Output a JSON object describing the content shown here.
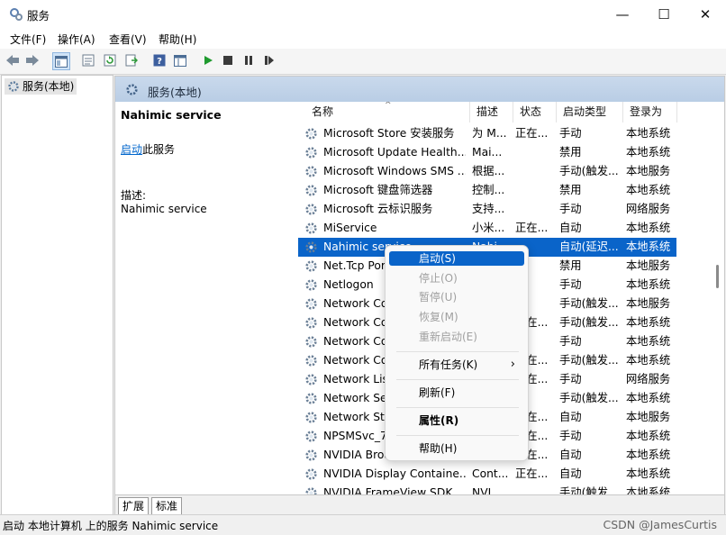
{
  "window": {
    "title": "服务",
    "controls": {
      "minimize": "—",
      "maximize": "☐",
      "close": "✕"
    }
  },
  "menubar": {
    "items": [
      "文件(F)",
      "操作(A)",
      "查看(V)",
      "帮助(H)"
    ]
  },
  "toolbar": {
    "icons": [
      "back-arrow-icon",
      "forward-arrow-icon",
      "show-hide-tree-icon",
      "properties-icon",
      "refresh-icon",
      "export-list-icon",
      "help-icon",
      "view-icon",
      "start-service-icon",
      "stop-service-icon",
      "pause-service-icon",
      "restart-service-icon"
    ]
  },
  "tree": {
    "item_label": "服务(本地)"
  },
  "panel": {
    "title": "服务(本地)",
    "detail": {
      "service_name": "Nahimic service",
      "action_link": "启动",
      "action_suffix": "此服务",
      "desc_label": "描述:",
      "desc_value": "Nahimic service"
    },
    "columns": [
      "名称",
      "描述",
      "状态",
      "启动类型",
      "登录为"
    ],
    "rows": [
      {
        "name": "Microsoft Store 安装服务",
        "desc": "为 M...",
        "status": "正在...",
        "startup": "手动",
        "logon": "本地系统"
      },
      {
        "name": "Microsoft Update Health...",
        "desc": "Mai...",
        "status": "",
        "startup": "禁用",
        "logon": "本地系统"
      },
      {
        "name": "Microsoft Windows SMS ...",
        "desc": "根据...",
        "status": "",
        "startup": "手动(触发...",
        "logon": "本地服务"
      },
      {
        "name": "Microsoft 键盘筛选器",
        "desc": "控制...",
        "status": "",
        "startup": "禁用",
        "logon": "本地系统"
      },
      {
        "name": "Microsoft 云标识服务",
        "desc": "支持...",
        "status": "",
        "startup": "手动",
        "logon": "网络服务"
      },
      {
        "name": "MiService",
        "desc": "小米...",
        "status": "正在...",
        "startup": "自动",
        "logon": "本地系统"
      },
      {
        "name": "Nahimic service",
        "desc": "Nahi...",
        "status": "",
        "startup": "自动(延迟...",
        "logon": "本地系统",
        "selected": true
      },
      {
        "name": "Net.Tcp Port Sharing",
        "desc": "",
        "status": "",
        "startup": "禁用",
        "logon": "本地服务"
      },
      {
        "name": "Netlogon",
        "desc": "",
        "status": "",
        "startup": "手动",
        "logon": "本地系统"
      },
      {
        "name": "Network Connected",
        "desc": "",
        "status": "",
        "startup": "手动(触发...",
        "logon": "本地服务"
      },
      {
        "name": "Network Connection",
        "desc": "",
        "status": "正在...",
        "startup": "手动(触发...",
        "logon": "本地系统"
      },
      {
        "name": "Network Connections",
        "desc": "",
        "status": "",
        "startup": "手动",
        "logon": "本地系统"
      },
      {
        "name": "Network Connectivity",
        "desc": "",
        "status": "正在...",
        "startup": "手动(触发...",
        "logon": "本地系统"
      },
      {
        "name": "Network List Service",
        "desc": "",
        "status": "正在...",
        "startup": "手动",
        "logon": "网络服务"
      },
      {
        "name": "Network Setup Service",
        "desc": "",
        "status": "",
        "startup": "手动(触发...",
        "logon": "本地系统"
      },
      {
        "name": "Network Store Interface",
        "desc": "",
        "status": "正在...",
        "startup": "自动",
        "logon": "本地服务"
      },
      {
        "name": "NPSMSvc_7d2f6",
        "desc": "",
        "status": "正在...",
        "startup": "手动",
        "logon": "本地系统"
      },
      {
        "name": "NVIDIA Broadcast",
        "desc": "",
        "status": "正在...",
        "startup": "自动",
        "logon": "本地系统"
      },
      {
        "name": "NVIDIA Display Containe...",
        "desc": "Cont...",
        "status": "正在...",
        "startup": "自动",
        "logon": "本地系统"
      },
      {
        "name": "NVIDIA FrameView SDK",
        "desc": "NVI...",
        "status": "",
        "startup": "手动(触发...",
        "logon": "本地系统"
      }
    ],
    "tabs": [
      "扩展",
      "标准"
    ]
  },
  "context_menu": {
    "items": [
      {
        "label": "启动(S)",
        "state": "highlighted"
      },
      {
        "label": "停止(O)",
        "state": "disabled"
      },
      {
        "label": "暂停(U)",
        "state": "disabled"
      },
      {
        "label": "恢复(M)",
        "state": "disabled"
      },
      {
        "label": "重新启动(E)",
        "state": "disabled"
      },
      {
        "label": "所有任务(K)",
        "state": "normal",
        "submenu": "›"
      },
      {
        "label": "刷新(F)",
        "state": "normal"
      },
      {
        "label": "属性(R)",
        "state": "bold"
      },
      {
        "label": "帮助(H)",
        "state": "normal"
      }
    ]
  },
  "statusbar": {
    "text": "启动 本地计算机 上的服务 Nahimic service"
  },
  "watermark": "CSDN @JamesCurtis",
  "colors": {
    "selection": "#0a64c9",
    "panel_header": "#c9d9ec"
  }
}
